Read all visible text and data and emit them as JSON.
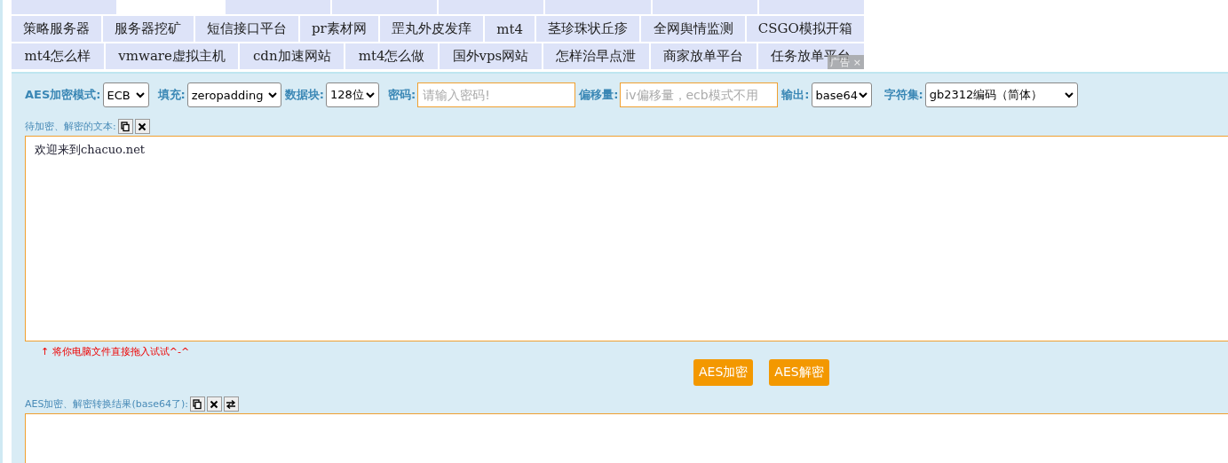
{
  "cut_row": [
    {
      "selected": false
    },
    {
      "selected": true
    },
    {
      "selected": false
    },
    {
      "selected": false
    },
    {
      "selected": false
    },
    {
      "selected": false
    },
    {
      "selected": false
    },
    {
      "selected": false
    }
  ],
  "link_rows": [
    [
      "策略服务器",
      "服务器挖矿",
      "短信接口平台",
      "pr素材网",
      "罡丸外皮发痒",
      "mt4",
      "茎珍珠状丘疹",
      "全网舆情监测",
      "CSGO模拟开箱"
    ],
    [
      "mt4怎么样",
      "vmware虚拟主机",
      "cdn加速网站",
      "mt4怎么做",
      "国外vps网站",
      "怎样治早点泄",
      "商家放单平台",
      "任务放单平台"
    ]
  ],
  "ad_badge": {
    "label": "广告",
    "close": "×"
  },
  "options": [
    {
      "label": "AES加密模式:",
      "kind": "select",
      "value": "ECB"
    },
    {
      "label": "填充:",
      "kind": "select",
      "value": "zeropadding"
    },
    {
      "label": "数据块:",
      "kind": "select",
      "value": "128位"
    },
    {
      "label": "密码:",
      "kind": "input",
      "placeholder": "请输入密码!"
    },
    {
      "label": "偏移量:",
      "kind": "input",
      "placeholder": "iv偏移量，ecb模式不用"
    },
    {
      "label": "输出:",
      "kind": "select",
      "value": "base64"
    },
    {
      "label": "字符集:",
      "kind": "select",
      "value": "gb2312编码（简体）"
    }
  ],
  "input_section": {
    "label": "待加密、解密的文本:",
    "tools": [
      {
        "kind": "copy"
      },
      {
        "kind": "clear"
      }
    ],
    "value": "欢迎来到chacuo.net",
    "hint_arrow": "↑",
    "hint": "将你电脑文件直接拖入试试^-^"
  },
  "buttons": [
    "AES加密",
    "AES解密"
  ],
  "output_section": {
    "label": "AES加密、解密转换结果(base64了):",
    "tools": [
      {
        "kind": "copy"
      },
      {
        "kind": "clear"
      },
      {
        "kind": "swap"
      }
    ]
  }
}
